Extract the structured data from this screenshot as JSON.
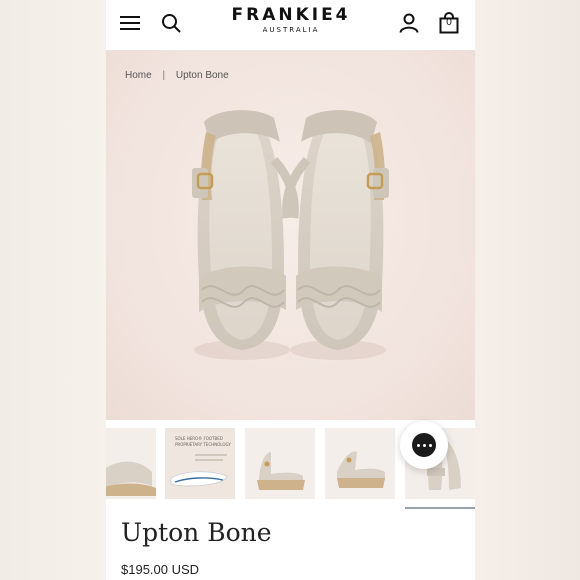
{
  "header": {
    "brand": "FRANKIE4",
    "brand_sub": "AUSTRALIA",
    "bag_count": "0",
    "icons": [
      "menu-icon",
      "search-icon",
      "account-icon",
      "shopping-bag-icon"
    ]
  },
  "breadcrumb": {
    "home": "Home",
    "separator": "|",
    "current": "Upton Bone"
  },
  "gallery": {
    "thumbnails": [
      {
        "name": "thumb-side-detail"
      },
      {
        "name": "thumb-footbed",
        "heading": "SOLE HERO® FOOTBED",
        "subheading": "PROPRIETARY TECHNOLOGY"
      },
      {
        "name": "thumb-side-view"
      },
      {
        "name": "thumb-angle-view"
      },
      {
        "name": "thumb-top-view"
      }
    ],
    "active_index": 4
  },
  "product": {
    "title": "Upton Bone",
    "price": "$195.00 USD"
  },
  "colors": {
    "hero_bg": "#f1e3dd",
    "shoe": "#d9d1c6",
    "strap": "#cfc6b9",
    "sole_jute": "#cdb28c",
    "chat": "#1a1a1a"
  }
}
